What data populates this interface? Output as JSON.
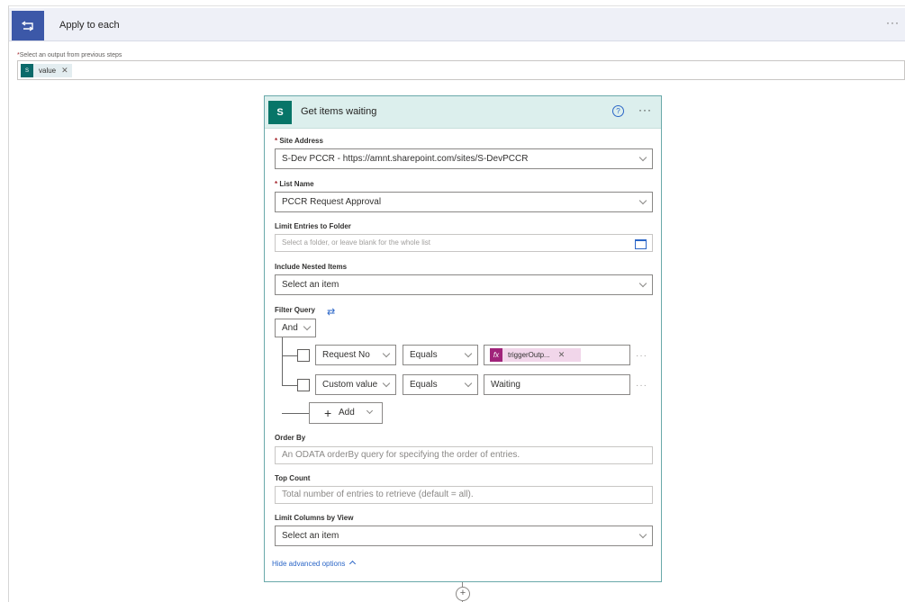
{
  "apply_each": {
    "title": "Apply to each",
    "more": "···",
    "icon": "loop-icon",
    "select_label": "Select an output from previous steps",
    "token": {
      "label": "value",
      "icon_text": "S"
    }
  },
  "action": {
    "title": "Get items waiting",
    "icon_text": "S",
    "help": "?",
    "more": "···",
    "site_address": {
      "label": "Site Address",
      "value": "S-Dev PCCR - https://amnt.sharepoint.com/sites/S-DevPCCR"
    },
    "list_name": {
      "label": "List Name",
      "value": "PCCR Request Approval"
    },
    "limit_folder": {
      "label": "Limit Entries to Folder",
      "placeholder": "Select a folder, or leave blank for the whole list"
    },
    "nested": {
      "label": "Include Nested Items",
      "value": "Select an item"
    },
    "filter": {
      "label": "Filter Query",
      "group_operator": "And",
      "rows": [
        {
          "field": "Request No",
          "operator": "Equals",
          "token": "triggerOutp...",
          "value": ""
        },
        {
          "field": "Custom value",
          "operator": "Equals",
          "token": "",
          "value": "Waiting"
        }
      ],
      "add_label": "Add"
    },
    "order_by": {
      "label": "Order By",
      "placeholder": "An ODATA orderBy query for specifying the order of entries."
    },
    "top_count": {
      "label": "Top Count",
      "placeholder": "Total number of entries to retrieve (default = all)."
    },
    "limit_columns": {
      "label": "Limit Columns by View",
      "value": "Select an item"
    },
    "hide_advanced": "Hide advanced options"
  },
  "add_step": "+",
  "colors": {
    "accent": "#3c58a8",
    "sharepoint": "#077568",
    "expression": "#a0237a",
    "link": "#2b66c7"
  }
}
